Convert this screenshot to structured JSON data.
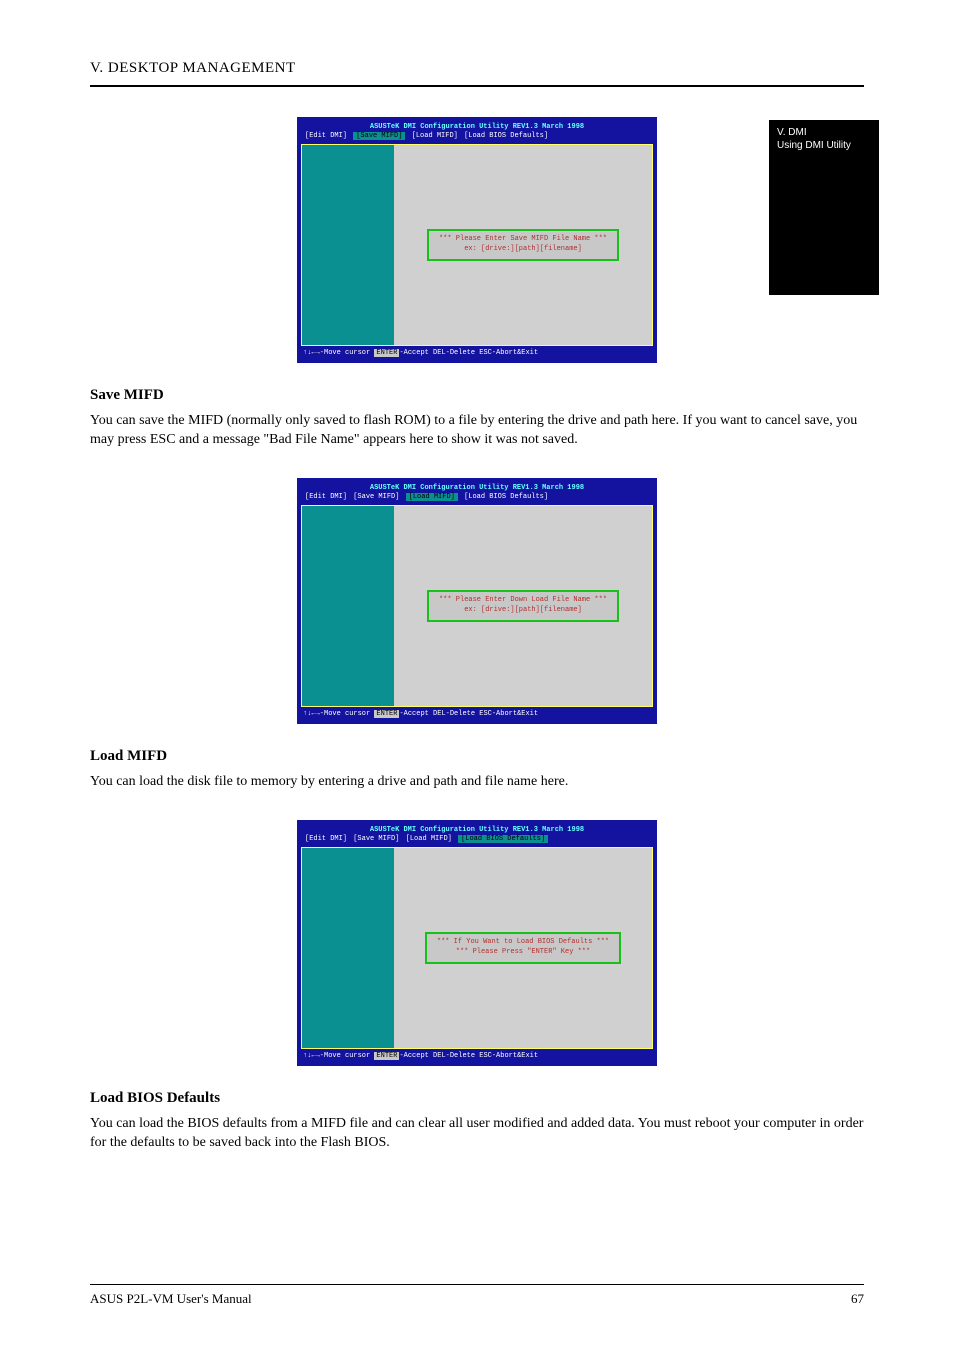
{
  "header": {
    "title": "V. DESKTOP MANAGEMENT"
  },
  "tab": {
    "line1": "V. DMI",
    "line2": "Using DMI Utility"
  },
  "screenshots": {
    "common": {
      "title": "ASUSTeK DMI Configuration Utility  REV1.3  March 1998",
      "status_prefix": "↑↓←→-Move cursor ",
      "status_enter": "ENTER",
      "status_rest": "-Accept  DEL-Delete  ESC-Abort&Exit"
    },
    "save": {
      "menu": "[Edit DMI] [Save MIFD] [Load MIFD] [Load BIOS Defaults]",
      "menu_active_index": 1,
      "prompt_line1": "*** Please Enter Save MIFD File Name ***",
      "prompt_line2": "ex: [drive:][path][filename]"
    },
    "load": {
      "menu": "[Edit DMI] [Save MIFD] [Load MIFD] [Load BIOS Defaults]",
      "menu_active_index": 2,
      "prompt_line1": "*** Please Enter Down Load File Name ***",
      "prompt_line2": "ex: [drive:][path][filename]"
    },
    "defaults": {
      "menu": "[Edit DMI] [Save MIFD] [Load MIFD] [Load BIOS Defaults]",
      "menu_active_index": 3,
      "prompt_line1": "*** If You Want to Load BIOS Defaults ***",
      "prompt_line2": "*** Please Press \"ENTER\" Key ***"
    }
  },
  "sections": {
    "save": {
      "heading": "Save MIFD",
      "body": "You can save the MIFD (normally only saved to flash ROM) to a file by entering the drive and path here. If you want to cancel save, you may press ESC and a message \"Bad File Name\" appears here to show it was not saved."
    },
    "load": {
      "heading": "Load MIFD",
      "body": "You can load the disk file to memory by entering a drive and path and file name here."
    },
    "defaults": {
      "heading": "Load BIOS Defaults",
      "body": "You can load the BIOS defaults from a MIFD file and can clear all user modified and added data. You must reboot your computer in order for the defaults to be saved back into the Flash BIOS."
    }
  },
  "footer": {
    "left": "ASUS P2L-VM User's Manual",
    "right": "67"
  }
}
